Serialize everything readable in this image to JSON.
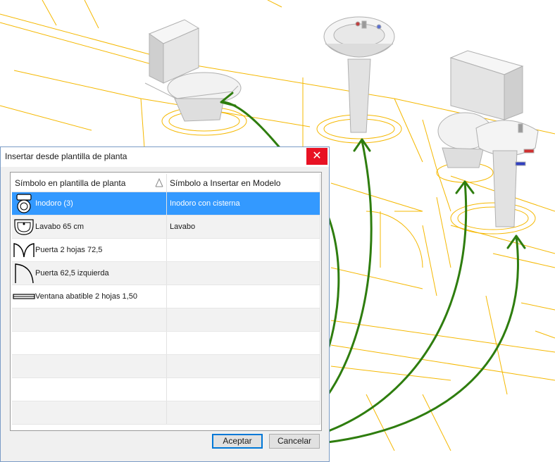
{
  "dialog": {
    "title": "Insertar desde plantilla de planta",
    "close_glyph": "✕",
    "columns": [
      "Símbolo en plantilla de planta",
      "Símbolo a Insertar en Modelo"
    ],
    "rows": [
      {
        "symbol": "Inodoro (3)",
        "model": "Inodoro con cisterna",
        "icon": "toilet-plan-icon",
        "selected": true
      },
      {
        "symbol": "Lavabo 65 cm",
        "model": "Lavabo",
        "icon": "washbasin-plan-icon"
      },
      {
        "symbol": "Puerta 2 hojas 72,5",
        "model": "",
        "icon": "double-door-plan-icon"
      },
      {
        "symbol": "Puerta 62,5 izquierda",
        "model": "",
        "icon": "door-left-plan-icon"
      },
      {
        "symbol": "Ventana abatible 2 hojas 1,50",
        "model": "",
        "icon": "window-plan-icon"
      },
      {
        "symbol": "",
        "model": ""
      },
      {
        "symbol": "",
        "model": ""
      },
      {
        "symbol": "",
        "model": ""
      },
      {
        "symbol": "",
        "model": ""
      },
      {
        "symbol": "",
        "model": ""
      }
    ],
    "ok_label": "Aceptar",
    "cancel_label": "Cancelar"
  },
  "colors": {
    "plan_lines": "#f5b800",
    "arrows": "#2e7d0e",
    "selection": "#3399ff",
    "close": "#e81123",
    "fixture": "#eaeaea"
  }
}
